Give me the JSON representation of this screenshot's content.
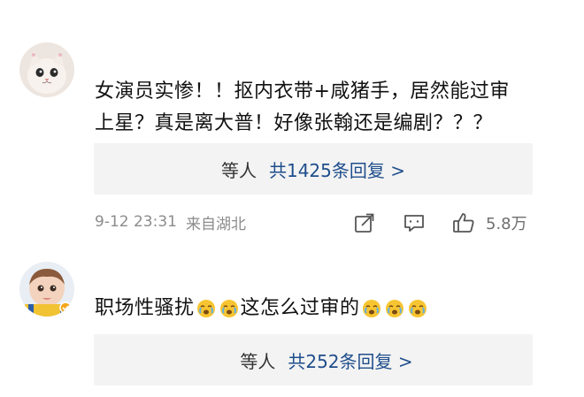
{
  "comments": [
    {
      "avatar": "cat-avatar",
      "text_line1": "女演员实惨！！抠内衣带+咸猪手，居然能过审",
      "text_line2": "上星？真是离大普！好像张翰还是编剧？？？",
      "replies": {
        "who": "等人",
        "count_label": "共1425条回复 >"
      },
      "meta": {
        "time": "9-12 23:31",
        "location": "来自湖北",
        "likes": "5.8万"
      },
      "icons": [
        "share-icon",
        "comment-icon",
        "like-icon"
      ]
    },
    {
      "avatar": "child-avatar",
      "text_before": "职场性骚扰",
      "text_after": "这怎么过审的",
      "emoji": "crying-face-emoji",
      "replies": {
        "who": "等人",
        "count_label": "共252条回复 >"
      }
    }
  ],
  "colors": {
    "reply_link": "#1f4e8c",
    "meta_text": "#8c8c8c",
    "reply_bg": "#f3f3f3"
  }
}
